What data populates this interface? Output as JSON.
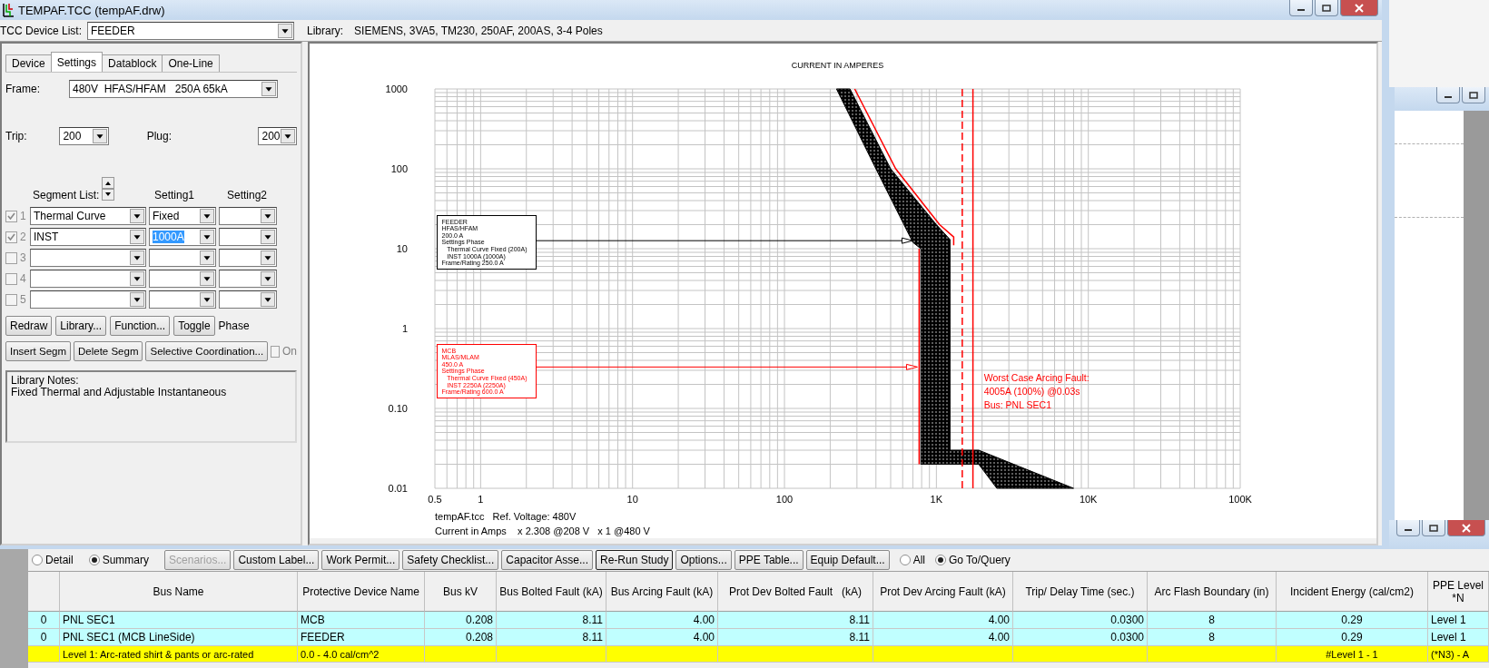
{
  "window": {
    "title": "TEMPAF.TCC (tempAF.drw)"
  },
  "device_list": {
    "label": "TCC Device List:",
    "value": "FEEDER"
  },
  "library": {
    "label": "Library:",
    "value": "SIEMENS, 3VA5, TM230, 250AF, 200AS, 3-4 Poles"
  },
  "tabs": [
    {
      "label": "Device",
      "selected": false
    },
    {
      "label": "Settings",
      "selected": true
    },
    {
      "label": "Datablock",
      "selected": false
    },
    {
      "label": "One-Line",
      "selected": false
    }
  ],
  "frame": {
    "label": "Frame:",
    "value": "480V  HFAS/HFAM   250A 65kA"
  },
  "trip": {
    "label": "Trip:",
    "value": "200"
  },
  "plug": {
    "label": "Plug:",
    "value": "200"
  },
  "segment_headers": [
    "Segment List:",
    "Setting1",
    "Setting2"
  ],
  "segments": [
    {
      "number": "1",
      "checked": true,
      "segment": "Thermal Curve",
      "setting1": "Fixed",
      "highlighted": false
    },
    {
      "number": "2",
      "checked": true,
      "segment": "INST",
      "setting1": "1000A",
      "highlighted": true
    },
    {
      "number": "3",
      "checked": false
    },
    {
      "number": "4",
      "checked": false
    },
    {
      "number": "5",
      "checked": false
    }
  ],
  "buttons_row1": [
    "Redraw",
    "Library...",
    "Function...",
    "Toggle"
  ],
  "phase_label": "Phase",
  "buttons_row2": [
    "Insert Segm",
    "Delete Segm",
    "Selective Coordination..."
  ],
  "on_checkbox": {
    "label": "On",
    "checked": false
  },
  "library_notes": {
    "title": "Library Notes:",
    "text": "Fixed Thermal and Adjustable Instantaneous"
  },
  "chart": {
    "title": "CURRENT IN AMPERES",
    "y_labels": [
      "1000",
      "100",
      "10",
      "1",
      "0.10",
      "0.01"
    ],
    "x_labels": [
      "0.5",
      "1",
      "10",
      "100",
      "1K",
      "10K",
      "100K"
    ],
    "callouts": [
      {
        "color": "#000000",
        "lines": [
          "FEEDER",
          "HFAS/HFAM",
          "200.0 A",
          "Settings Phase",
          "   Thermal Curve Fixed (200A)",
          "   INST 1000A (1000A)",
          "Frame/Rating 250.0 A"
        ]
      },
      {
        "color": "#ff0000",
        "lines": [
          "MCB",
          "MLAS/MLAM",
          "450.0 A",
          "Settings Phase",
          "   Thermal Curve Fixed (450A)",
          "   INST 2250A (2250A)",
          "Frame/Rating 600.0 A"
        ]
      }
    ],
    "fault_note": [
      "Worst Case Arcing Fault:",
      "4005A (100%) @0.03s",
      "Bus: PNL SEC1"
    ],
    "footer": [
      "tempAF.tcc   Ref. Voltage: 480V",
      "Current in Amps    x 2.308 @208 V   x 1 @480 V"
    ]
  },
  "study": {
    "view_options": [
      {
        "label": "Detail",
        "selected": false
      },
      {
        "label": "Summary",
        "selected": true
      }
    ],
    "buttons": [
      {
        "label": "Scenarios...",
        "disabled": true,
        "default": false
      },
      {
        "label": "Custom Label...",
        "disabled": false,
        "default": false
      },
      {
        "label": "Work Permit...",
        "disabled": false,
        "default": false
      },
      {
        "label": "Safety Checklist...",
        "disabled": false,
        "default": false
      },
      {
        "label": "Capacitor Asse...",
        "disabled": false,
        "default": false
      },
      {
        "label": "Re-Run Study",
        "disabled": false,
        "default": true
      },
      {
        "label": "Options...",
        "disabled": false,
        "default": false
      },
      {
        "label": "PPE Table...",
        "disabled": false,
        "default": false
      },
      {
        "label": "Equip Default...",
        "disabled": false,
        "default": false
      }
    ],
    "filter_options": [
      {
        "label": "All",
        "selected": false
      },
      {
        "label": "Go To/Query",
        "selected": true
      }
    ],
    "table": {
      "columns": [
        null,
        "Bus Name",
        "Protective Device Name",
        "Bus kV",
        "Bus Bolted Fault (kA)",
        "Bus Arcing Fault (kA)",
        "Prot Dev Bolted Fault   (kA)",
        "Prot Dev Arcing Fault (kA)",
        "Trip/ Delay Time (sec.)",
        "Arc Flash Boundary (in)",
        "Incident Energy (cal/cm2)",
        "PPE Level *N"
      ],
      "rows": [
        {
          "color": "#c0ffff",
          "cells": [
            "0",
            "PNL SEC1",
            "MCB",
            "0.208",
            "8.11",
            "4.00",
            "8.11",
            "4.00",
            "0.0300",
            "8",
            "0.29",
            "Level 1"
          ]
        },
        {
          "color": "#c0ffff",
          "cells": [
            "0",
            "PNL SEC1 (MCB LineSide)",
            "FEEDER",
            "0.208",
            "8.11",
            "4.00",
            "8.11",
            "4.00",
            "0.0300",
            "8",
            "0.29",
            "Level 1"
          ]
        },
        {
          "color": "#ffff00",
          "cells": [
            null,
            "Level 1: Arc-rated shirt & pants or arc-rated",
            "0.0 - 4.0 cal/cm^2",
            null,
            null,
            null,
            null,
            null,
            null,
            null,
            "#Level 1 - 1",
            "(*N3) - A"
          ]
        }
      ]
    }
  }
}
